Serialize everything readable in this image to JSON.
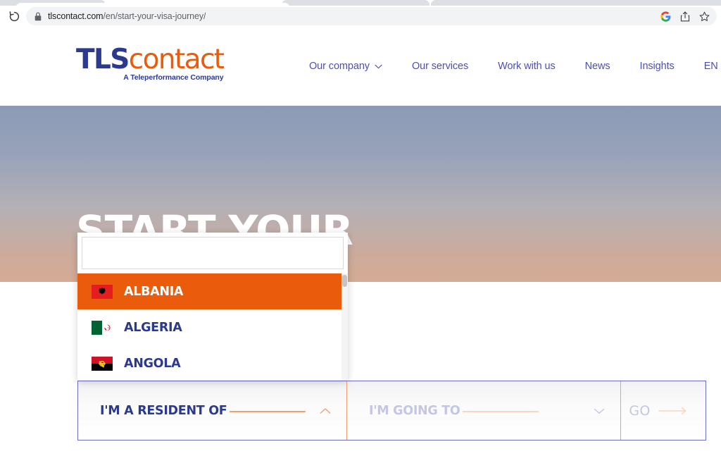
{
  "browser": {
    "reload_icon": "reload-icon",
    "lock_icon": "lock-icon",
    "url_host": "tlscontact.com",
    "url_path": "/en/start-your-visa-journey/",
    "icons": [
      {
        "name": "google-icon",
        "label": "G"
      },
      {
        "name": "share-icon",
        "label": ""
      },
      {
        "name": "bookmark-star-icon",
        "label": ""
      }
    ]
  },
  "header": {
    "logo": {
      "part1": "TLS",
      "part2": "contact",
      "tagline": "A Teleperformance Company"
    },
    "nav": [
      {
        "label": "Our company",
        "has_chevron": true
      },
      {
        "label": "Our services",
        "has_chevron": false
      },
      {
        "label": "Work with us",
        "has_chevron": false
      },
      {
        "label": "News",
        "has_chevron": false
      },
      {
        "label": "Insights",
        "has_chevron": false
      },
      {
        "label": "EN",
        "has_chevron": true
      }
    ]
  },
  "hero": {
    "title": "START YOUR",
    "gradient_top": "#8b9ab6",
    "gradient_bottom": "#d4ab95"
  },
  "dropdown": {
    "search_value": "",
    "search_placeholder": "",
    "items": [
      {
        "label": "ALBANIA",
        "flag": "albania-flag",
        "selected": true
      },
      {
        "label": "ALGERIA",
        "flag": "algeria-flag",
        "selected": false
      },
      {
        "label": "ANGOLA",
        "flag": "angola-flag",
        "selected": false
      }
    ],
    "highlight_color": "#ea5b0c"
  },
  "selector": {
    "resident_label": "I'M A RESIDENT OF",
    "resident_value": "",
    "resident_chevron": "chevron-up-icon",
    "going_label": "I'M GOING TO",
    "going_value": "",
    "going_chevron": "chevron-down-icon",
    "go_label": "GO",
    "go_arrow": "arrow-right-icon",
    "accent_color": "#f0a070",
    "border_color": "#6b6fc0"
  }
}
